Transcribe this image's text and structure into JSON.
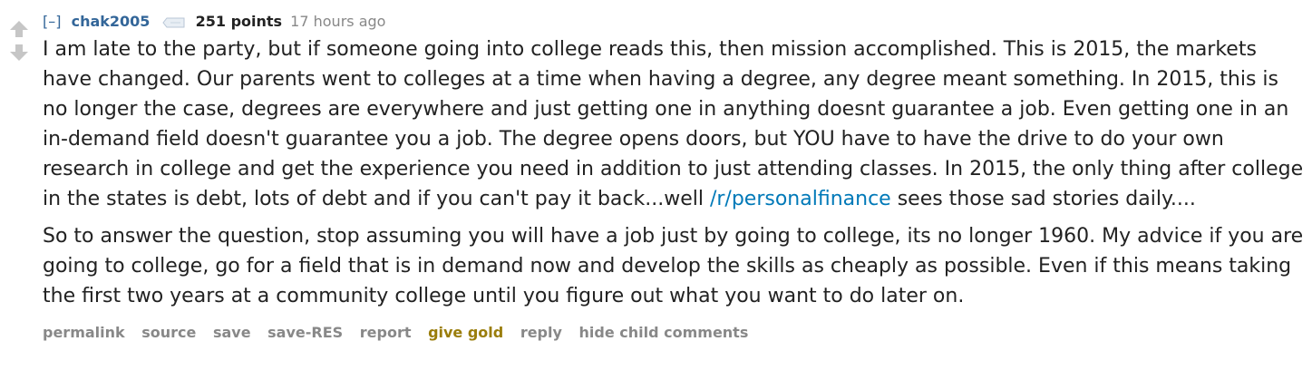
{
  "comment": {
    "expand_label": "[–]",
    "author": "chak2005",
    "user_tag_icon": "tag-icon",
    "score": "251 points",
    "timestamp": "17 hours ago",
    "body": {
      "p1_part1": "I am late to the party, but if someone going into college reads this, then mission accomplished. This is 2015, the markets have changed. Our parents went to colleges at a time when having a degree, any degree meant something. In 2015, this is no longer the case, degrees are everywhere and just getting one in anything doesnt guarantee a job. Even getting one in an in-demand field doesn't guarantee you a job. The degree opens doors, but YOU have to have the drive to do your own research in college and get the experience you need in addition to just attending classes. In 2015, the only thing after college in the states is debt, lots of debt and if you can't pay it back...well",
      "link_text": "/r/personalfinance",
      "p1_part2": " sees those sad stories daily....",
      "p2": "So to answer the question, stop assuming you will have a job just by going to college, its no longer 1960. My advice if you are going to college, go for a field that is in demand now and develop the skills as cheaply as possible. Even if this means taking the first two years at a community college until you figure out what you want to do later on."
    },
    "buttons": {
      "permalink": "permalink",
      "source": "source",
      "save": "save",
      "save_res": "save-RES",
      "report": "report",
      "give_gold": "give gold",
      "reply": "reply",
      "hide_children": "hide child comments"
    },
    "colors": {
      "author": "#336699",
      "link": "#0079b8",
      "gold": "#9a7d0a",
      "muted": "#888888"
    }
  }
}
